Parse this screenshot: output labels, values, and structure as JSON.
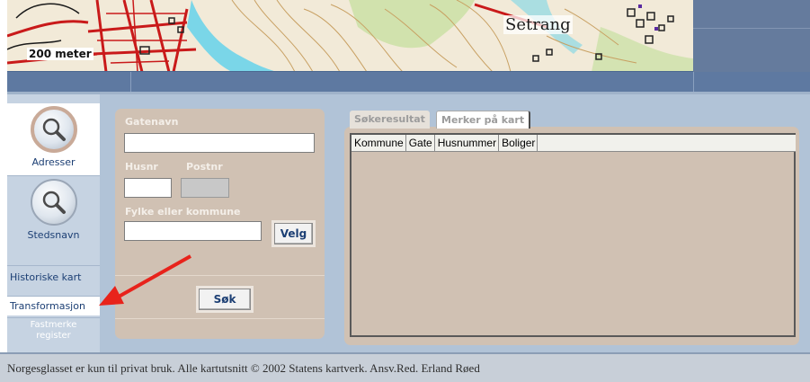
{
  "map": {
    "place_label": "Setrang",
    "scale_label": "200 meter",
    "colors": {
      "background": "#f2ead8",
      "roads": "#c91a1a",
      "contours": "#c8a062",
      "water": "#7ad6e8",
      "forest": "#b9d98c"
    }
  },
  "sidebar": {
    "adresser_label": "Adresser",
    "stedsnavn_label": "Stedsnavn",
    "historiske_label": "Historiske kart",
    "transformasjon_label": "Transformasjon",
    "fastmerke_label_1": "Fastmerke",
    "fastmerke_label_2": "register",
    "icons": {
      "adresser": "magnifier-icon",
      "stedsnavn": "magnifier-icon"
    }
  },
  "form": {
    "gatenavn_label": "Gatenavn",
    "gatenavn_value": "",
    "husnr_label": "Husnr",
    "husnr_value": "",
    "postnr_label": "Postnr",
    "postnr_value": "",
    "fylke_label": "Fylke eller kommune",
    "fylke_value": "",
    "velg_label": "Velg",
    "sok_label": "Søk"
  },
  "results": {
    "tabs": [
      {
        "label": "Søkeresultat"
      },
      {
        "label": "Merker på kart"
      }
    ],
    "columns": [
      "Kommune",
      "Gate",
      "Husnummer",
      "Boliger"
    ]
  },
  "status": {
    "text": "Norgesglasset er kun til privat bruk. Alle kartutsnitt © 2002 Statens kartverk. Ansv.Red. Erland Røed"
  },
  "colors": {
    "accent_arrow": "#e8231b",
    "panel": "#d0c1b3",
    "frame": "#b1c3d7",
    "band": "#5e79a1"
  }
}
